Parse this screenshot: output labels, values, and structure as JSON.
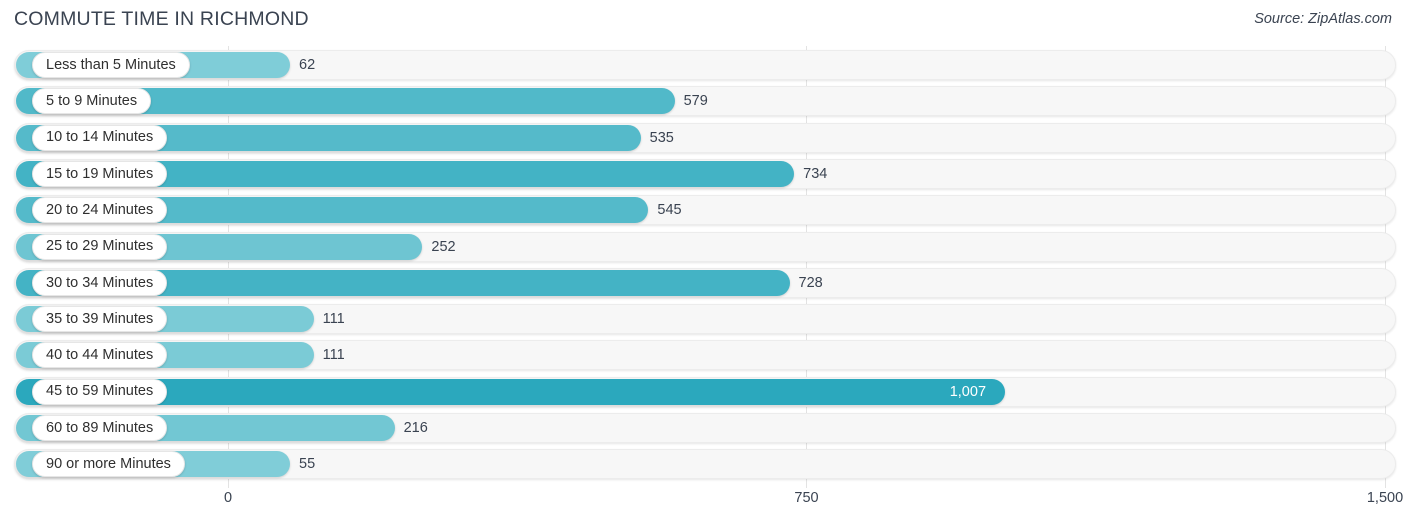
{
  "header": {
    "title": "COMMUTE TIME IN RICHMOND",
    "source": "Source: ZipAtlas.com"
  },
  "colors": {
    "bar_min": "#80cdd8",
    "bar_mid": "#4bb8c9",
    "bar_max": "#2ba8bd",
    "track": "#f7f7f7",
    "gridline": "#e3e3e3",
    "text": "#3a4351",
    "value_inside_text": "#ffffff"
  },
  "chart_data": {
    "type": "bar",
    "orientation": "horizontal",
    "title": "COMMUTE TIME IN RICHMOND",
    "xlabel": "",
    "ylabel": "",
    "xlim": [
      0,
      1500
    ],
    "grid": true,
    "legend": null,
    "xticks": [
      0,
      750,
      1500
    ],
    "xtick_labels": [
      "0",
      "750",
      "1,500"
    ],
    "categories": [
      "Less than 5 Minutes",
      "5 to 9 Minutes",
      "10 to 14 Minutes",
      "15 to 19 Minutes",
      "20 to 24 Minutes",
      "25 to 29 Minutes",
      "30 to 34 Minutes",
      "35 to 39 Minutes",
      "40 to 44 Minutes",
      "45 to 59 Minutes",
      "60 to 89 Minutes",
      "90 or more Minutes"
    ],
    "values": [
      62,
      579,
      535,
      734,
      545,
      252,
      728,
      111,
      111,
      1007,
      216,
      55
    ],
    "value_labels": [
      "62",
      "579",
      "535",
      "734",
      "545",
      "252",
      "728",
      "111",
      "111",
      "1,007",
      "216",
      "55"
    ]
  }
}
